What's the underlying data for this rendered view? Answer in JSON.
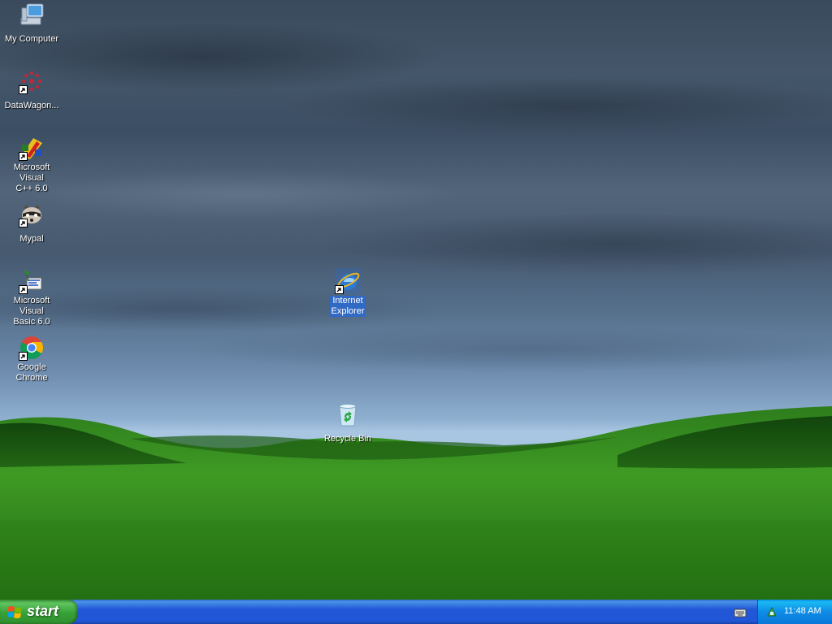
{
  "desktop": {
    "icons": [
      {
        "label": "My Computer"
      },
      {
        "label": "DataWagon..."
      },
      {
        "label_line1": "Microsoft Visual",
        "label_line2": "C++ 6.0"
      },
      {
        "label": "Mypal"
      },
      {
        "label_line1": "Microsoft Visual",
        "label_line2": "Basic 6.0"
      },
      {
        "label": "Google Chrome"
      },
      {
        "label_line1": "Internet",
        "label_line2": "Explorer",
        "selected": true
      },
      {
        "label": "Recycle Bin"
      }
    ]
  },
  "taskbar": {
    "start_label": "start",
    "clock": "11:48 AM"
  },
  "colors": {
    "taskbar_blue": "#2157d7",
    "start_green": "#37a137",
    "tray_blue": "#0e8ce6",
    "selection": "#316ac5"
  }
}
